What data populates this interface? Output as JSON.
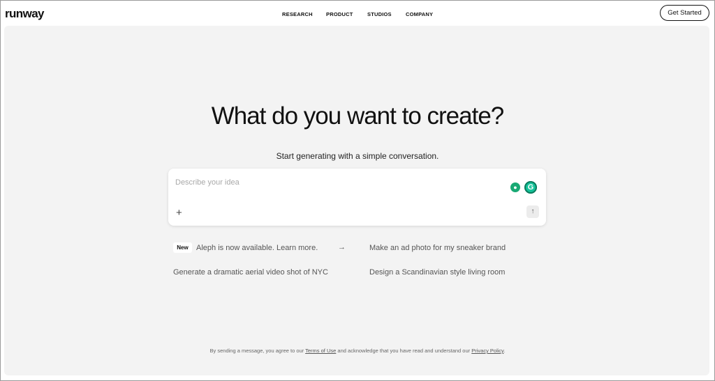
{
  "brand": {
    "logo": "runway"
  },
  "nav": {
    "items": [
      "RESEARCH",
      "PRODUCT",
      "STUDIOS",
      "COMPANY"
    ],
    "cta": "Get Started"
  },
  "hero": {
    "headline": "What do you want to create?",
    "subline": "Start generating with a simple conversation."
  },
  "prompt": {
    "placeholder": "Describe your idea",
    "value": "",
    "icons": [
      "plus-icon",
      "send-arrow-icon",
      "lightbulb-extension-icon",
      "grammarly-icon"
    ]
  },
  "suggestions": {
    "badge": "New",
    "announcement": "Aleph is now available. Learn more.",
    "items": [
      "Make an ad photo for my sneaker brand",
      "Generate a dramatic aerial video shot of NYC",
      "Design a Scandinavian style living room"
    ]
  },
  "footer": {
    "prefix": "By sending a message, you agree to our",
    "terms_link": "Terms of Use",
    "middle": "and acknowledge that you have read and understand our",
    "privacy_link": "Privacy Policy",
    "suffix": "."
  },
  "colors": {
    "background": "#f3f3f3",
    "card": "#ffffff",
    "text": "#111111",
    "muted": "#555555"
  }
}
